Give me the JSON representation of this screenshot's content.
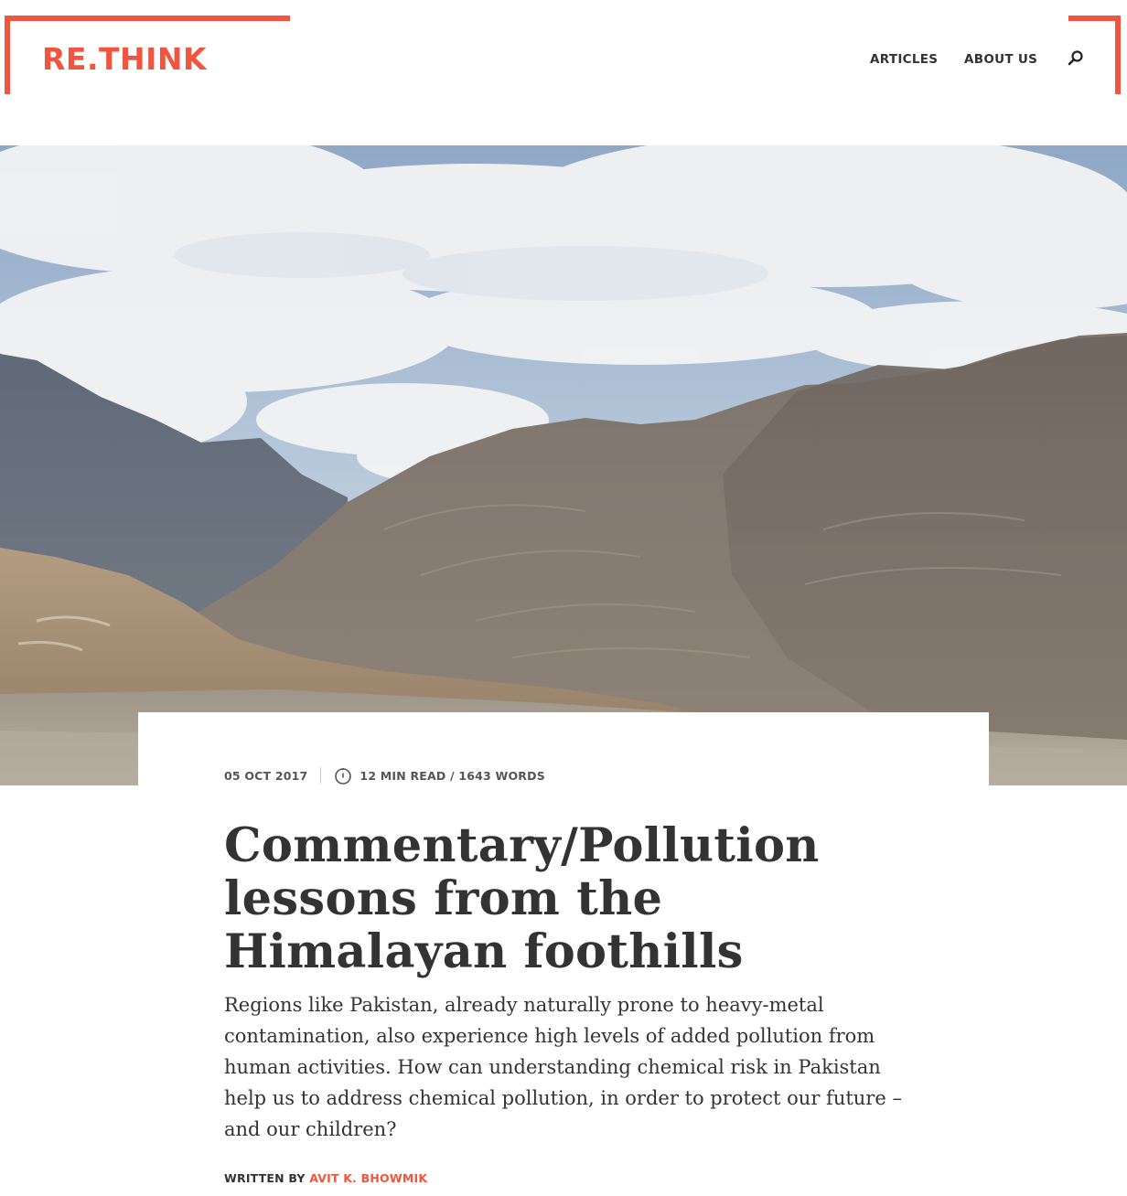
{
  "brand": {
    "logo": "RE.THINK",
    "accent_color": "#f0553f"
  },
  "nav": {
    "items": [
      {
        "label": "ARTICLES"
      },
      {
        "label": "ABOUT US"
      }
    ],
    "search_icon": "search-icon"
  },
  "hero": {
    "image": "mountain-landscape-with-cloudy-sky"
  },
  "article": {
    "date": "05 OCT 2017",
    "read_time_icon": "clock-icon",
    "read_time": "12 MIN READ / 1643 WORDS",
    "category": "Commentary/",
    "title": "Pollution lessons from the Himalayan foothills",
    "summary": "Regions like Pakistan, already naturally prone to heavy-metal contamination, also experience high levels of added pollution from human activities. How can understanding chemical risk in Pakistan help us to address chemical pollution, in order to protect our future – and our children?",
    "byline_prefix": "WRITTEN BY",
    "author": "AVIT K. BHOWMIK"
  }
}
